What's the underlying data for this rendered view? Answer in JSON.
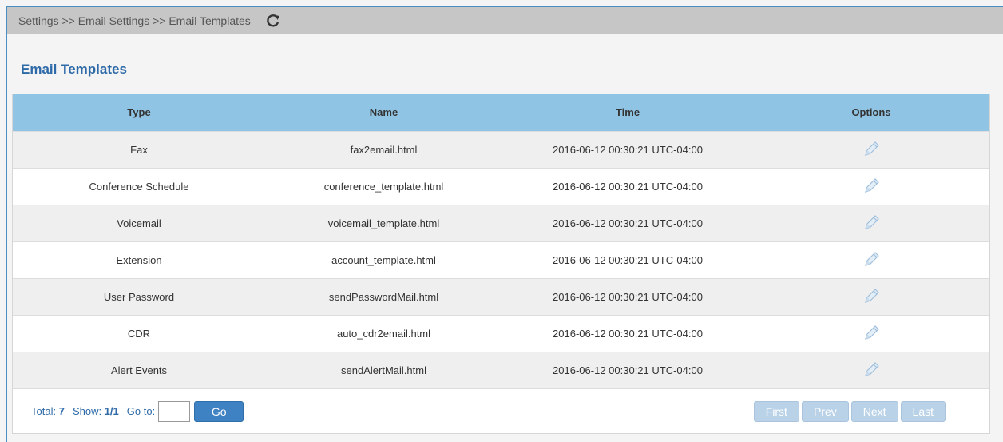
{
  "breadcrumb": {
    "text": "Settings >> Email Settings >> Email Templates",
    "refresh_icon": "refresh-icon"
  },
  "page_title": "Email Templates",
  "table": {
    "columns": [
      "Type",
      "Name",
      "Time",
      "Options"
    ],
    "rows": [
      {
        "type": "Fax",
        "name": "fax2email.html",
        "time": "2016-06-12 00:30:21 UTC-04:00",
        "option_icon": "pencil-edit-icon"
      },
      {
        "type": "Conference Schedule",
        "name": "conference_template.html",
        "time": "2016-06-12 00:30:21 UTC-04:00",
        "option_icon": "pencil-edit-icon"
      },
      {
        "type": "Voicemail",
        "name": "voicemail_template.html",
        "time": "2016-06-12 00:30:21 UTC-04:00",
        "option_icon": "pencil-edit-icon"
      },
      {
        "type": "Extension",
        "name": "account_template.html",
        "time": "2016-06-12 00:30:21 UTC-04:00",
        "option_icon": "pencil-edit-icon"
      },
      {
        "type": "User Password",
        "name": "sendPasswordMail.html",
        "time": "2016-06-12 00:30:21 UTC-04:00",
        "option_icon": "pencil-edit-icon"
      },
      {
        "type": "CDR",
        "name": "auto_cdr2email.html",
        "time": "2016-06-12 00:30:21 UTC-04:00",
        "option_icon": "pencil-edit-icon"
      },
      {
        "type": "Alert Events",
        "name": "sendAlertMail.html",
        "time": "2016-06-12 00:30:21 UTC-04:00",
        "option_icon": "pencil-edit-icon"
      }
    ]
  },
  "footer": {
    "total_label": "Total:",
    "total_value": "7",
    "show_label": "Show:",
    "show_value": "1/1",
    "goto_label": "Go to:",
    "goto_value": "",
    "go_button": "Go",
    "pager": {
      "first": "First",
      "prev": "Prev",
      "next": "Next",
      "last": "Last"
    }
  },
  "colors": {
    "header_bg": "#90c4e4",
    "title": "#2e6aa8",
    "go_button": "#3f82c4",
    "pager_disabled": "#b9d2e8"
  }
}
